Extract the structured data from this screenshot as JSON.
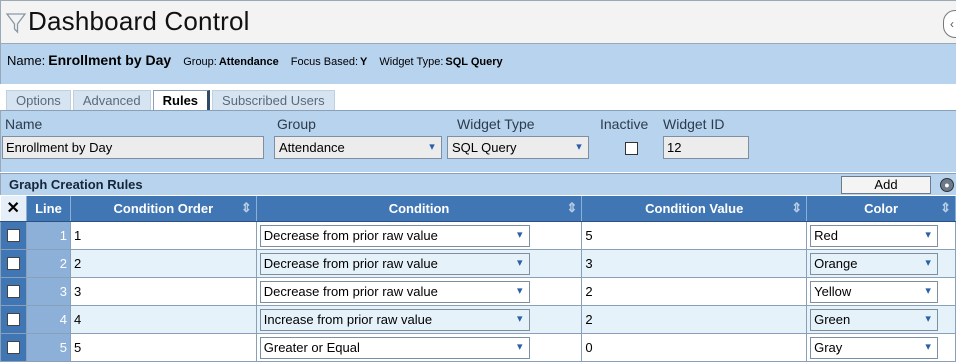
{
  "title": "Dashboard Control",
  "info": {
    "name_label": "Name:",
    "name_value": "Enrollment by Day",
    "group_label": "Group:",
    "group_value": "Attendance",
    "focus_label": "Focus Based:",
    "focus_value": "Y",
    "type_label": "Widget Type:",
    "type_value": "SQL Query"
  },
  "tabs": [
    {
      "label": "Options"
    },
    {
      "label": "Advanced"
    },
    {
      "label": "Rules"
    },
    {
      "label": "Subscribed Users"
    }
  ],
  "form": {
    "name_label": "Name",
    "name_value": "Enrollment by Day",
    "group_label": "Group",
    "group_value": "Attendance",
    "widget_type_label": "Widget Type",
    "widget_type_value": "SQL Query",
    "inactive_label": "Inactive",
    "widget_id_label": "Widget ID",
    "widget_id_value": "12"
  },
  "grid": {
    "title": "Graph Creation Rules",
    "add_label": "Add",
    "columns": {
      "select": "✕",
      "line": "Line",
      "order": "Condition Order",
      "condition": "Condition",
      "value": "Condition Value",
      "color": "Color"
    },
    "rows": [
      {
        "line": "1",
        "order": "1",
        "condition": "Decrease from prior raw value",
        "value": "5",
        "color": "Red"
      },
      {
        "line": "2",
        "order": "2",
        "condition": "Decrease from prior raw value",
        "value": "3",
        "color": "Orange"
      },
      {
        "line": "3",
        "order": "3",
        "condition": "Decrease from prior raw value",
        "value": "2",
        "color": "Yellow"
      },
      {
        "line": "4",
        "order": "4",
        "condition": "Increase from prior raw value",
        "value": "2",
        "color": "Green"
      },
      {
        "line": "5",
        "order": "5",
        "condition": "Greater or Equal",
        "value": "0",
        "color": "Gray"
      }
    ]
  },
  "icons": {
    "filter": "funnel-icon",
    "collapse": "collapse-icon",
    "dropdown": "chevron-down-icon",
    "settings": "gear-icon",
    "sort": "sort-icon"
  },
  "colors": {
    "header_blue": "#3f76b3",
    "panel_blue": "#b8d3ee",
    "row_alt": "#e6f2fa"
  }
}
